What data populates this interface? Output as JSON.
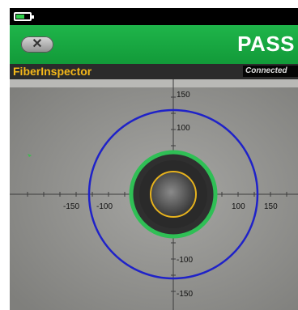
{
  "status": {
    "battery": "battery-icon"
  },
  "header": {
    "close_icon": "close-icon",
    "result": "PASS"
  },
  "titlebar": {
    "app_name": "FiberInspector",
    "connection": "Connected"
  },
  "axes": {
    "x_labels": [
      "-150",
      "-100",
      "100",
      "150"
    ],
    "y_labels": [
      "150",
      "100",
      "-100",
      "-150"
    ]
  },
  "colors": {
    "header_green": "#1fb54a",
    "outer_ring": "#1f22c8",
    "cladding_ring": "#2fbf55",
    "core_ring": "#e6b21e",
    "title_text": "#f5b81a"
  }
}
